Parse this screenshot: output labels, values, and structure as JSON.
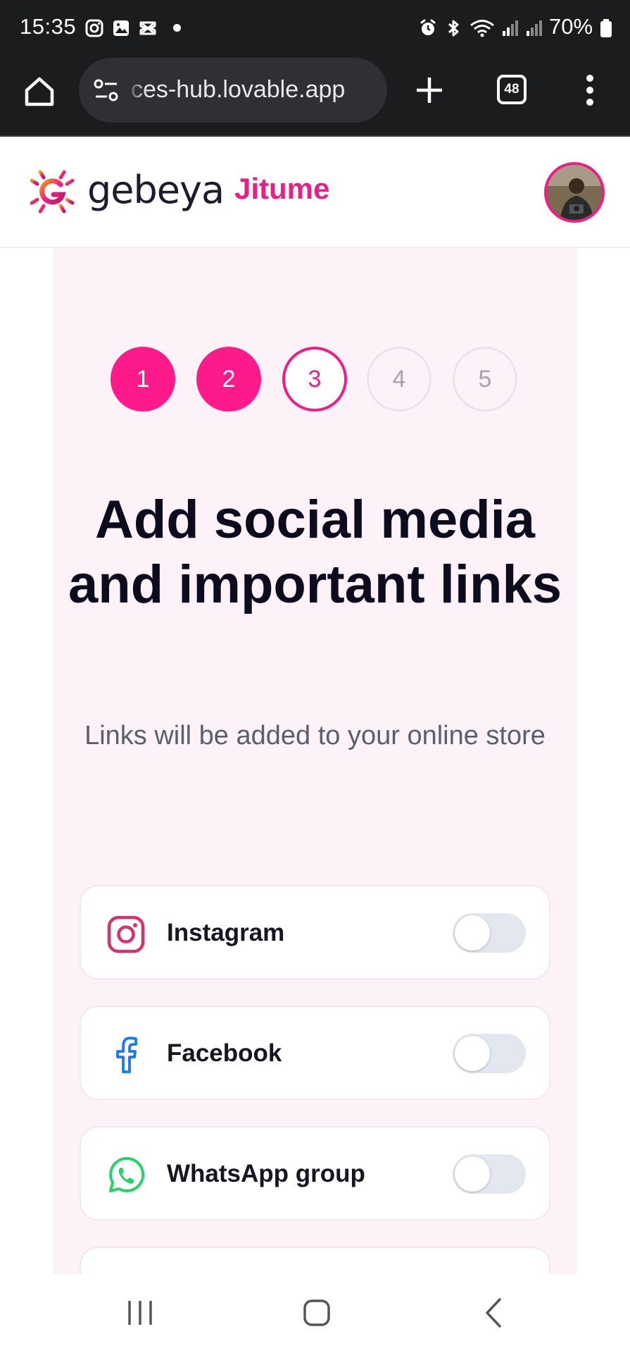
{
  "status_bar": {
    "time": "15:35",
    "battery": "70%"
  },
  "browser": {
    "url": "ces-hub.lovable.app",
    "tab_count": "48"
  },
  "header": {
    "brand": "gebeya",
    "product": "Jitume"
  },
  "steps": [
    "1",
    "2",
    "3",
    "4",
    "5"
  ],
  "current_step": 3,
  "title": "Add social media and important links",
  "subtitle": "Links will be added to your online store",
  "links": [
    {
      "label": "Instagram",
      "icon": "instagram-icon",
      "enabled": false
    },
    {
      "label": "Facebook",
      "icon": "facebook-icon",
      "enabled": false
    },
    {
      "label": "WhatsApp group",
      "icon": "whatsapp-icon",
      "enabled": false
    }
  ],
  "colors": {
    "accent": "#ee1e87",
    "page_tint": "#fdf2f8",
    "instagram": "#d6336c",
    "facebook": "#1877f2",
    "whatsapp": "#25d366"
  }
}
